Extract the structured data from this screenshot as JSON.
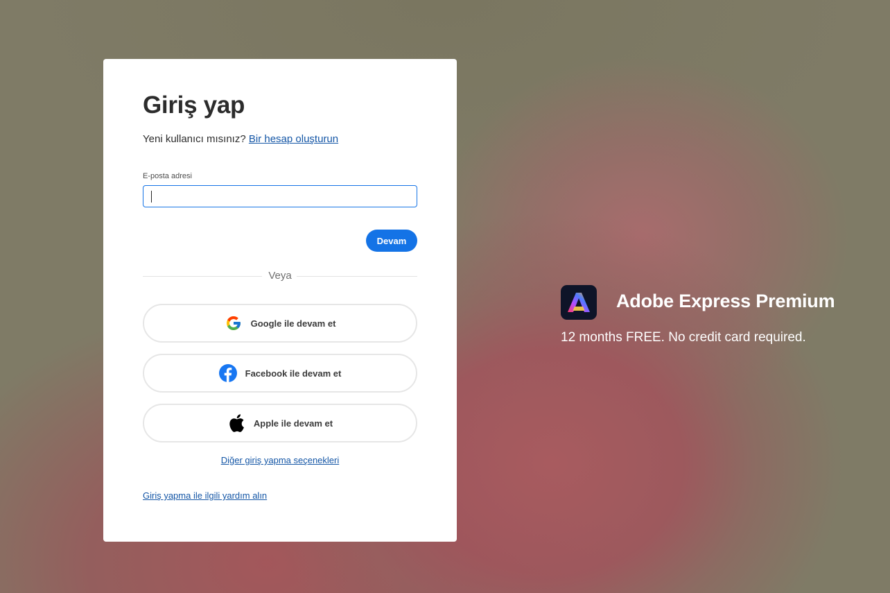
{
  "signin": {
    "title": "Giriş yap",
    "new_user_text": "Yeni kullanıcı mısınız?",
    "create_account_link": "Bir hesap oluşturun",
    "email_label": "E-posta adresi",
    "email_value": "",
    "continue_label": "Devam",
    "or_label": "Veya",
    "google_label": "Google ile devam et",
    "facebook_label": "Facebook ile devam et",
    "apple_label": "Apple ile devam et",
    "more_options_link": "Diğer giriş yapma seçenekleri",
    "help_link": "Giriş yapma ile ilgili yardım alın"
  },
  "promo": {
    "title": "Adobe Express Premium",
    "subtitle": "12 months FREE. No credit card required."
  },
  "icons": {
    "google": "google-logo-icon",
    "facebook": "facebook-logo-icon",
    "apple": "apple-logo-icon",
    "app": "adobe-express-logo-icon"
  },
  "colors": {
    "accent": "#1473e6",
    "link": "#1456a6",
    "facebook": "#1877f2"
  }
}
